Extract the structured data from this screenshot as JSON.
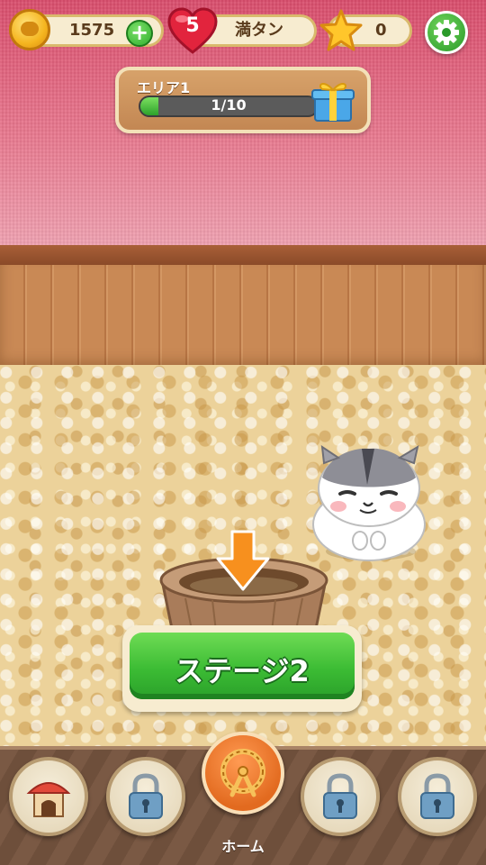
{
  "hud": {
    "coins": "1575",
    "lives": "5",
    "lives_status": "満タン",
    "stars": "0",
    "add_coins_icon": "plus-icon",
    "settings_icon": "gear-icon"
  },
  "area": {
    "title": "エリア1",
    "progress_text": "1/10",
    "progress_fraction": 0.1,
    "reward_icon": "gift-box-icon"
  },
  "stage_button": {
    "label": "ステージ2"
  },
  "nav": {
    "items": [
      {
        "name": "house",
        "icon": "hamster-house-icon",
        "locked": false
      },
      {
        "name": "locked-1",
        "icon": "lock-icon",
        "locked": true
      },
      {
        "name": "home",
        "icon": "hamster-wheel-icon",
        "label": "ホーム",
        "active": true
      },
      {
        "name": "locked-2",
        "icon": "lock-icon",
        "locked": true
      },
      {
        "name": "locked-3",
        "icon": "lock-icon",
        "locked": true
      }
    ]
  },
  "colors": {
    "wall": "#e06a82",
    "fence": "#c98955",
    "accent_green": "#3cbc34",
    "home_orange": "#e26a1f"
  }
}
